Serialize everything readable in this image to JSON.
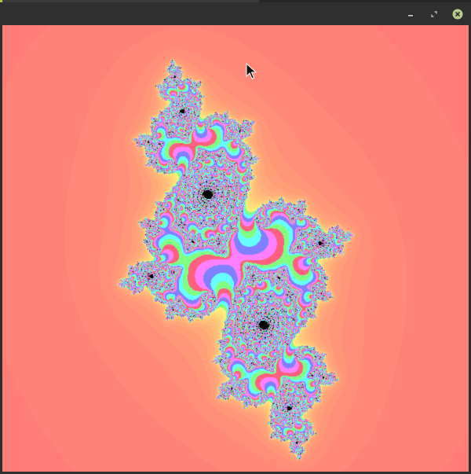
{
  "window": {
    "title": "",
    "buttons": {
      "minimize_icon": "minimize-icon",
      "maximize_icon": "restore-icon",
      "close_icon": "close-icon"
    }
  },
  "fractal": {
    "type": "julia-set",
    "colors": {
      "background": "#ff7a78",
      "glow": "#fff07a",
      "set": "#000000",
      "accents": [
        "#80ff80",
        "#66ffff",
        "#8080ff",
        "#ff80ff",
        "#ff6080"
      ]
    }
  }
}
